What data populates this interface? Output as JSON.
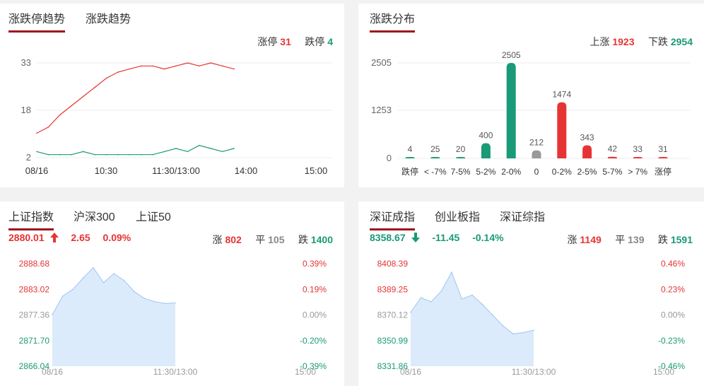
{
  "limit_trend": {
    "tabs": [
      "涨跌停趋势",
      "涨跌趋势"
    ],
    "stats": {
      "up_label": "涨停",
      "up_value": "31",
      "down_label": "跌停",
      "down_value": "4"
    },
    "y_ticks": [
      "33",
      "18",
      "2"
    ],
    "x_ticks": [
      "08/16",
      "10:30",
      "11:30/13:00",
      "14:00",
      "15:00"
    ]
  },
  "distribution": {
    "title": "涨跌分布",
    "stats": {
      "up_label": "上涨",
      "up_value": "1923",
      "down_label": "下跌",
      "down_value": "2954"
    },
    "y_ticks": [
      "2505",
      "1253",
      "0"
    ]
  },
  "sh_panel": {
    "tabs": [
      "上证指数",
      "沪深300",
      "上证50"
    ],
    "quote": {
      "price": "2880.01",
      "change": "2.65",
      "pct": "0.09%",
      "direction": "up-arrow-icon"
    },
    "breadth": {
      "up_label": "涨",
      "up": "802",
      "flat_label": "平",
      "flat": "105",
      "down_label": "跌",
      "down": "1400"
    },
    "left_ticks": [
      "2888.68",
      "2883.02",
      "2877.36",
      "2871.70",
      "2866.04"
    ],
    "right_ticks": [
      "0.39%",
      "0.19%",
      "0.00%",
      "-0.20%",
      "-0.39%"
    ],
    "x_ticks": [
      "08/16",
      "11:30/13:00",
      "15:00"
    ]
  },
  "sz_panel": {
    "tabs": [
      "深证成指",
      "创业板指",
      "深证综指"
    ],
    "quote": {
      "price": "8358.67",
      "change": "-11.45",
      "pct": "-0.14%",
      "direction": "down-arrow-icon"
    },
    "breadth": {
      "up_label": "涨",
      "up": "1149",
      "flat_label": "平",
      "flat": "139",
      "down_label": "跌",
      "down": "1591"
    },
    "left_ticks": [
      "8408.39",
      "8389.25",
      "8370.12",
      "8350.99",
      "8331.86"
    ],
    "right_ticks": [
      "0.46%",
      "0.23%",
      "0.00%",
      "-0.23%",
      "-0.46%"
    ],
    "x_ticks": [
      "08/16",
      "11:30/13:00",
      "15:00"
    ]
  },
  "colors": {
    "up": "#e63434",
    "down": "#1a9a77",
    "flat": "#999999",
    "accent": "#a0131b"
  },
  "chart_data": [
    {
      "type": "line",
      "ylim": [
        2,
        33
      ],
      "x": [
        "09:30",
        "09:40",
        "09:50",
        "10:00",
        "10:10",
        "10:20",
        "10:30",
        "10:40",
        "10:50",
        "11:00",
        "11:10",
        "11:20",
        "11:30",
        "13:10",
        "13:20",
        "13:30",
        "13:40",
        "13:50"
      ],
      "series": [
        {
          "name": "涨停",
          "values": [
            10,
            12,
            16,
            19,
            22,
            25,
            28,
            30,
            31,
            32,
            32,
            31,
            32,
            33,
            32,
            33,
            32,
            31
          ]
        },
        {
          "name": "跌停",
          "values": [
            4,
            3,
            3,
            3,
            4,
            3,
            3,
            3,
            3,
            3,
            3,
            4,
            5,
            4,
            6,
            5,
            4,
            5
          ]
        }
      ]
    },
    {
      "type": "bar",
      "categories": [
        "跌停",
        "< -7%",
        "7-5%",
        "5-2%",
        "2-0%",
        "0",
        "0-2%",
        "2-5%",
        "5-7%",
        "> 7%",
        "涨停"
      ],
      "values": [
        4,
        25,
        20,
        400,
        2505,
        212,
        1474,
        343,
        42,
        33,
        31
      ],
      "ylim": [
        0,
        2505
      ]
    },
    {
      "type": "area",
      "ylim": [
        2866.04,
        2888.68
      ],
      "x": [
        "09:30",
        "09:40",
        "09:50",
        "10:00",
        "10:10",
        "10:20",
        "10:30",
        "10:40",
        "10:50",
        "11:00",
        "11:10",
        "11:20",
        "11:30"
      ],
      "values": [
        2877.4,
        2881.5,
        2883.0,
        2885.5,
        2887.8,
        2884.5,
        2886.5,
        2885.0,
        2882.5,
        2881.0,
        2880.3,
        2879.9,
        2880.01
      ]
    },
    {
      "type": "area",
      "ylim": [
        8331.86,
        8408.39
      ],
      "x": [
        "09:30",
        "09:40",
        "09:50",
        "10:00",
        "10:10",
        "10:20",
        "10:30",
        "10:40",
        "10:50",
        "11:00",
        "11:10",
        "11:20",
        "11:30"
      ],
      "values": [
        8372.0,
        8383.0,
        8380.0,
        8388.0,
        8402.0,
        8382.0,
        8385.0,
        8378.0,
        8370.0,
        8362.0,
        8356.0,
        8357.0,
        8358.67
      ]
    }
  ]
}
